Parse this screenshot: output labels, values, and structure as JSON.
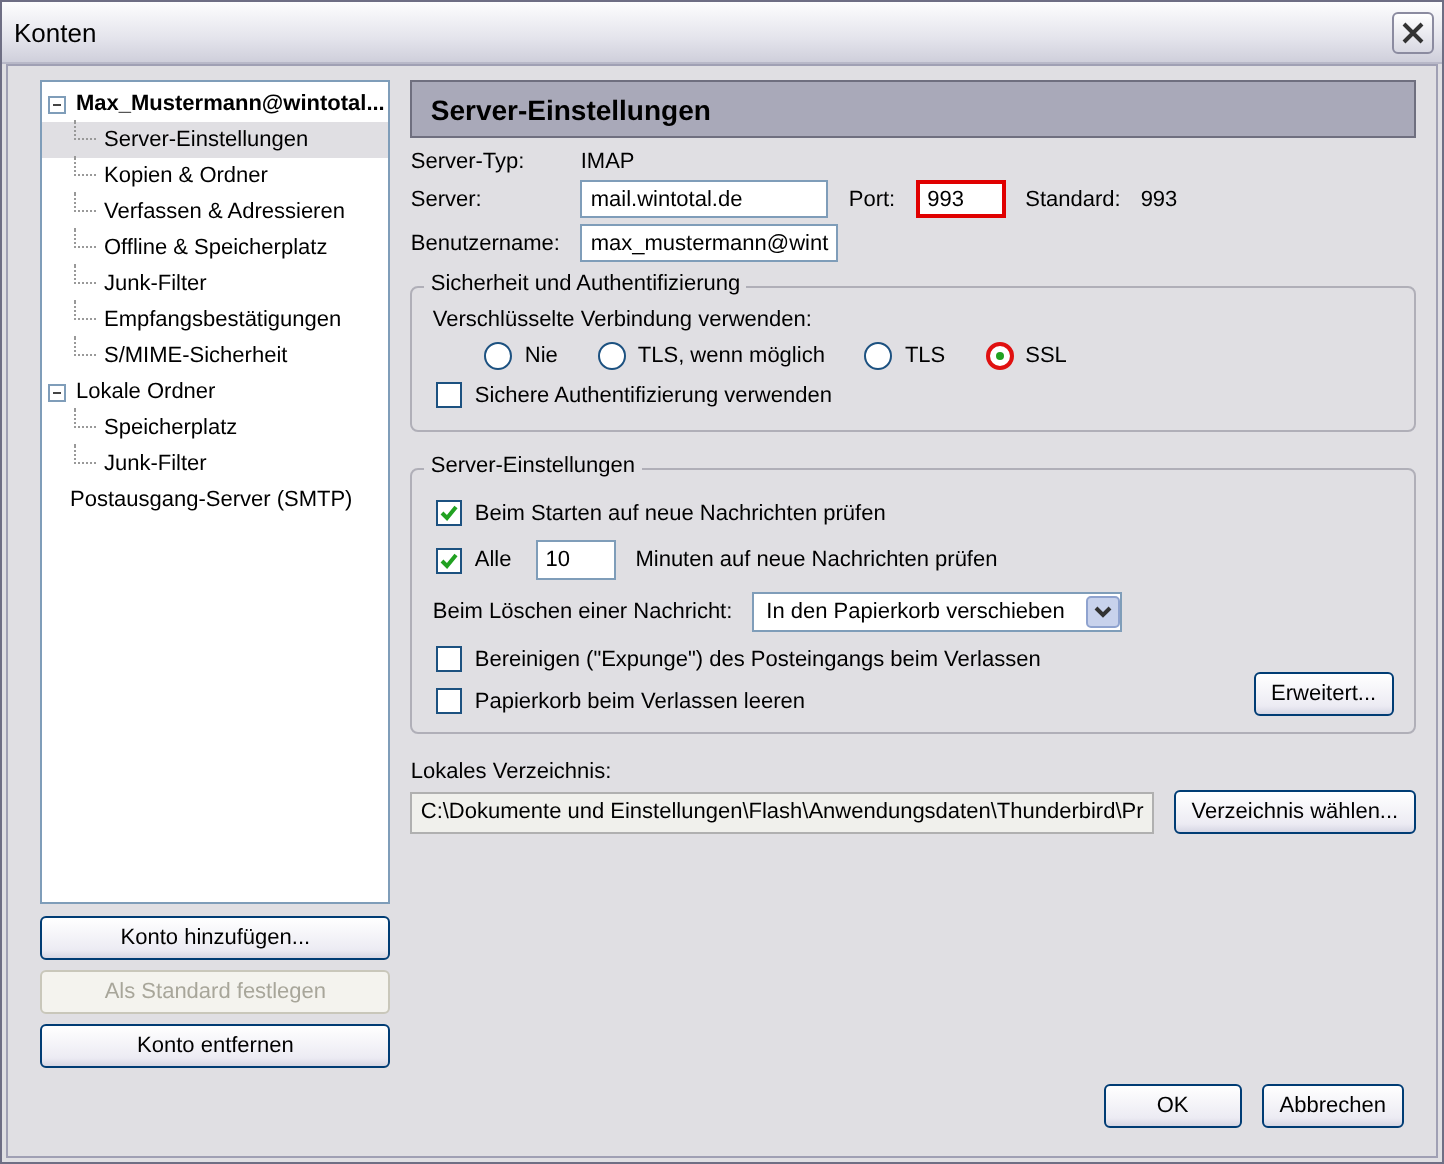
{
  "window": {
    "title": "Konten"
  },
  "tree": [
    {
      "label": "Max_Mustermann@wintotal...",
      "default": true,
      "selected": false,
      "expanded": true,
      "children": [
        {
          "label": "Server-Einstellungen",
          "selected": true
        },
        {
          "label": "Kopien & Ordner",
          "selected": false
        },
        {
          "label": "Verfassen & Adressieren",
          "selected": false
        },
        {
          "label": "Offline & Speicherplatz",
          "selected": false
        },
        {
          "label": "Junk-Filter",
          "selected": false
        },
        {
          "label": "Empfangsbestätigungen",
          "selected": false
        },
        {
          "label": "S/MIME-Sicherheit",
          "selected": false
        }
      ]
    },
    {
      "label": "Lokale Ordner",
      "default": false,
      "selected": false,
      "expanded": true,
      "children": [
        {
          "label": "Speicherplatz",
          "selected": false
        },
        {
          "label": "Junk-Filter",
          "selected": false
        }
      ]
    },
    {
      "label": "Postausgang-Server (SMTP)",
      "default": false,
      "selected": false
    }
  ],
  "account_buttons": [
    {
      "label": "Konto hinzufügen...",
      "disabled": false
    },
    {
      "label": "Als Standard festlegen",
      "disabled": true
    },
    {
      "label": "Konto entfernen",
      "disabled": false
    }
  ],
  "panel": {
    "title": "Server-Einstellungen",
    "server_type": {
      "label": "Server-Typ:",
      "value": "IMAP"
    },
    "server": {
      "label": "Server:",
      "value": "mail.wintotal.de"
    },
    "port": {
      "label": "Port:",
      "value": "993",
      "highlighted": true
    },
    "standard": {
      "label": "Standard:",
      "value": "993"
    },
    "username": {
      "label": "Benutzername:",
      "value": "max_mustermann@wint"
    },
    "security": {
      "title": "Sicherheit und Authentifizierung",
      "encryption_label": "Verschlüsselte Verbindung verwenden:",
      "options": [
        {
          "label": "Nie",
          "selected": false
        },
        {
          "label": "TLS, wenn möglich",
          "selected": false
        },
        {
          "label": "TLS",
          "selected": false
        },
        {
          "label": "SSL",
          "selected": true
        }
      ],
      "secure_auth": {
        "label": "Sichere Authentifizierung verwenden",
        "checked": false
      }
    },
    "server_settings": {
      "title": "Server-Einstellungen",
      "check_on_start": {
        "label": "Beim Starten auf neue Nachrichten prüfen",
        "checked": true
      },
      "check_every": {
        "label": "Alle",
        "checked": true,
        "value": "10",
        "suffix": "Minuten auf neue Nachrichten prüfen"
      },
      "delete_label": "Beim Löschen einer Nachricht:",
      "delete_action": "In den Papierkorb verschieben",
      "expunge": {
        "label": "Bereinigen (\"Expunge\") des Posteingangs beim Verlassen",
        "checked": false
      },
      "empty_trash": {
        "label": "Papierkorb beim Verlassen leeren",
        "checked": false
      },
      "advanced_button": "Erweitert..."
    },
    "local_dir": {
      "label": "Lokales Verzeichnis:",
      "value": "C:\\Dokumente und Einstellungen\\Flash\\Anwendungsdaten\\Thunderbird\\Pr",
      "button": "Verzeichnis wählen..."
    }
  },
  "footer_buttons": [
    "OK",
    "Abbrechen"
  ]
}
